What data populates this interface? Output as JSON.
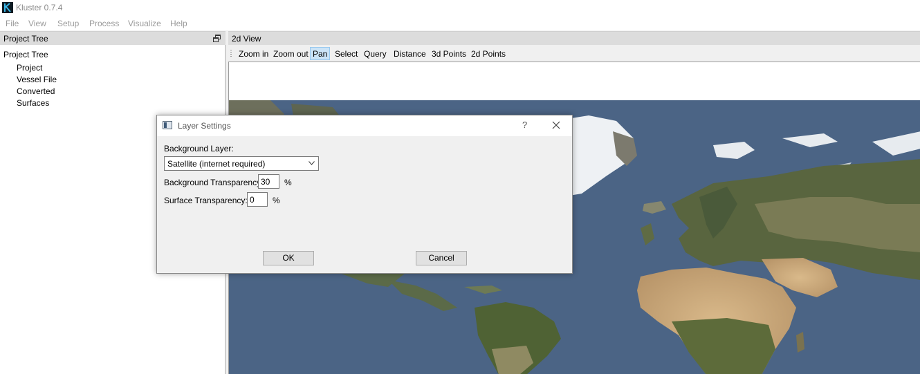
{
  "app": {
    "title": "Kluster 0.7.4",
    "icon": "kluster-logo-icon"
  },
  "menu": [
    "File",
    "View",
    "Setup",
    "Process",
    "Visualize",
    "Help"
  ],
  "project_tree": {
    "dock_title": "Project Tree",
    "root_label": "Project Tree",
    "items": [
      "Project",
      "Vessel File",
      "Converted",
      "Surfaces"
    ]
  },
  "view2d": {
    "dock_title": "2d View",
    "toolbar": [
      "Zoom in",
      "Zoom out",
      "Pan",
      "Select",
      "Query",
      "Distance",
      "3d Points",
      "2d Points"
    ],
    "active_tool": "Pan"
  },
  "dialog": {
    "title": "Layer Settings",
    "help_symbol": "?",
    "background_layer_label": "Background Layer:",
    "background_layer_value": "Satellite (internet required)",
    "background_transparency_label": "Background Transparency:",
    "background_transparency_value": "30",
    "surface_transparency_label": "Surface Transparency:",
    "surface_transparency_value": "0",
    "percent_unit": "%",
    "ok_label": "OK",
    "cancel_label": "Cancel"
  },
  "colors": {
    "ocean": "#4b6485",
    "active_tool_bg": "#cce4f7",
    "dock_header_bg": "#dcdcdc"
  }
}
